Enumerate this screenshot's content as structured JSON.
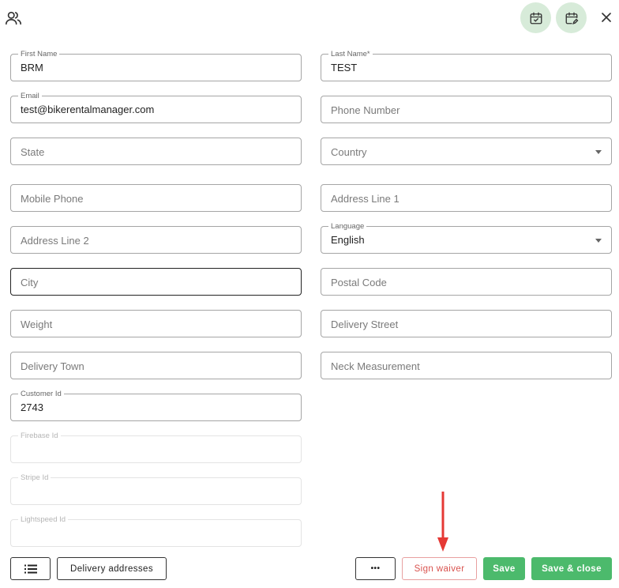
{
  "header": {
    "user_icon": "user-group-icon",
    "calendar_check_icon": "calendar-check-icon",
    "calendar_edit_icon": "calendar-edit-icon",
    "close_icon": "close-icon"
  },
  "fields": {
    "first_name": {
      "label": "First Name",
      "value": "BRM"
    },
    "last_name": {
      "label": "Last Name*",
      "value": "TEST"
    },
    "email": {
      "label": "Email",
      "value": "test@bikerentalmanager.com"
    },
    "phone_number": {
      "placeholder": "Phone Number"
    },
    "state": {
      "placeholder": "State"
    },
    "country": {
      "placeholder": "Country"
    },
    "mobile_phone": {
      "placeholder": "Mobile Phone"
    },
    "address_line_1": {
      "placeholder": "Address Line 1"
    },
    "address_line_2": {
      "placeholder": "Address Line 2"
    },
    "language": {
      "label": "Language",
      "value": "English"
    },
    "city": {
      "placeholder": "City"
    },
    "postal_code": {
      "placeholder": "Postal Code"
    },
    "weight": {
      "placeholder": "Weight"
    },
    "delivery_street": {
      "placeholder": "Delivery Street"
    },
    "delivery_town": {
      "placeholder": "Delivery Town"
    },
    "neck_measurement": {
      "placeholder": "Neck Measurement"
    },
    "customer_id": {
      "label": "Customer Id",
      "value": "2743"
    },
    "firebase_id": {
      "label": "Firebase Id",
      "value": ""
    },
    "stripe_id": {
      "label": "Stripe Id",
      "value": ""
    },
    "lightspeed_id": {
      "label": "Lightspeed Id",
      "value": ""
    }
  },
  "footer": {
    "list_icon": "list-icon",
    "delivery_addresses_label": "Delivery addresses",
    "more_label": "•••",
    "sign_waiver_label": "Sign waiver",
    "save_label": "Save",
    "save_close_label": "Save & close"
  },
  "colors": {
    "accent_green": "#4cba6c",
    "round_button_bg": "#d7ebd9",
    "danger_red": "#d9534f",
    "arrow_red": "#e53935"
  }
}
